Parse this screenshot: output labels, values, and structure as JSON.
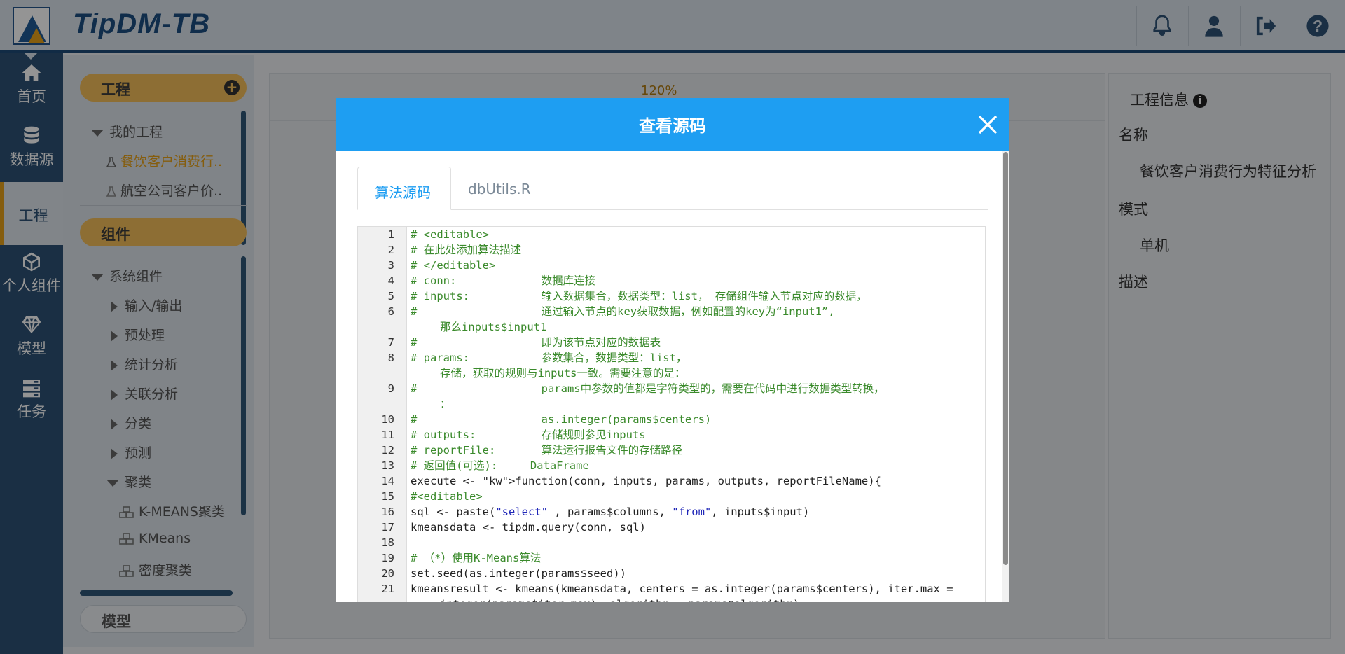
{
  "header": {
    "app_title": "TipDM-TB"
  },
  "leftnav": {
    "items": [
      {
        "label": "首页",
        "icon": "home-icon"
      },
      {
        "label": "数据源",
        "icon": "database-icon"
      },
      {
        "label": "工程",
        "icon": "none"
      },
      {
        "label": "个人组件",
        "icon": "cube-icon"
      },
      {
        "label": "模型",
        "icon": "diamond-icon"
      },
      {
        "label": "任务",
        "icon": "server-icon"
      }
    ]
  },
  "project_panel": {
    "section_project": "工程",
    "my_projects": "我的工程",
    "projects": [
      "餐饮客户消费行..",
      "航空公司客户价.."
    ],
    "section_components": "组件",
    "system_components": "系统组件",
    "categories": [
      "输入/输出",
      "预处理",
      "统计分析",
      "关联分析",
      "分类",
      "预测"
    ],
    "cluster": "聚类",
    "cluster_items": [
      "K-MEANS聚类",
      "KMeans",
      "密度聚类"
    ],
    "section_model": "模型"
  },
  "canvas": {
    "zoom_level": "120%"
  },
  "info_panel": {
    "title": "工程信息",
    "name_label": "名称",
    "name_value": "餐饮客户消费行为特征分析",
    "mode_label": "模式",
    "mode_value": "单机",
    "desc_label": "描述"
  },
  "modal": {
    "title": "查看源码",
    "tabs": [
      "算法源码",
      "dbUtils.R"
    ],
    "code_lines": [
      {
        "n": "1",
        "t": "# <editable>"
      },
      {
        "n": "2",
        "t": "# 在此处添加算法描述"
      },
      {
        "n": "3",
        "t": "# </editable>"
      },
      {
        "n": "4",
        "t": "# conn:             数据库连接"
      },
      {
        "n": "5",
        "t": "# inputs:           输入数据集合，数据类型：list， 存储组件输入节点对应的数据，"
      },
      {
        "n": "6",
        "t": "#                   通过输入节点的key获取数据，例如配置的key为“input1”,"
      },
      {
        "n": "",
        "t": "那么inputs$input1"
      },
      {
        "n": "7",
        "t": "#                   即为该节点对应的数据表"
      },
      {
        "n": "8",
        "t": "# params:           参数集合，数据类型：list，"
      },
      {
        "n": "",
        "t": "存储，获取的规则与inputs一致。需要注意的是："
      },
      {
        "n": "9",
        "t": "#                   params中参数的值都是字符类型的，需要在代码中进行数据类型转换，"
      },
      {
        "n": "",
        "t": "："
      },
      {
        "n": "10",
        "t": "#                   as.integer(params$centers)"
      },
      {
        "n": "11",
        "t": "# outputs:          存储规则参见inputs"
      },
      {
        "n": "12",
        "t": "# reportFile:       算法运行报告文件的存储路径"
      },
      {
        "n": "13",
        "t": "# 返回值(可选):     DataFrame"
      },
      {
        "n": "14",
        "t": "execute <- function(conn, inputs, params, outputs, reportFileName){"
      },
      {
        "n": "15",
        "t": "#<editable>"
      },
      {
        "n": "16",
        "t": "sql <- paste(\"select\" , params$columns, \"from\", inputs$input)"
      },
      {
        "n": "17",
        "t": "kmeansdata <- tipdm.query(conn, sql)"
      },
      {
        "n": "18",
        "t": ""
      },
      {
        "n": "19",
        "t": "# （*）使用K-Means算法"
      },
      {
        "n": "20",
        "t": "set.seed(as.integer(params$seed))"
      },
      {
        "n": "21",
        "t": "kmeansresult <- kmeans(kmeansdata, centers = as.integer(params$centers), iter.max ="
      },
      {
        "n": "",
        "t": "integer(params$iter.max), algorithm = params$algorithm)"
      }
    ]
  }
}
